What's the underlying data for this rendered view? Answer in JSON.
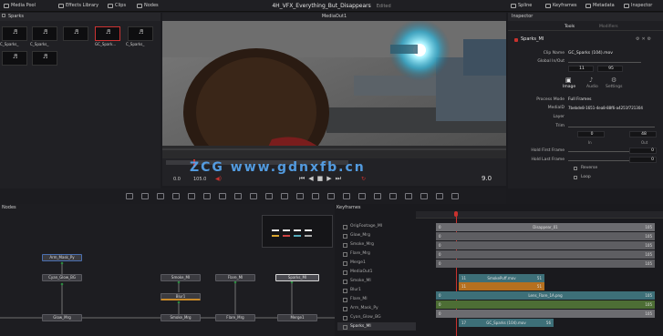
{
  "topbar": {
    "media_pool": "Media Pool",
    "effects_library": "Effects Library",
    "clips": "Clips",
    "nodes": "Nodes",
    "project_title": "4H_VFX_Everything_But_Disappears",
    "edited": "Edited",
    "spline": "Spline",
    "keyframes": "Keyframes",
    "metadata": "Metadata",
    "inspector": "Inspector"
  },
  "media_pool": {
    "bin": "Sparks",
    "clips": [
      "C_Sparks_",
      "C_Sparks_",
      "",
      "GC_Spark...",
      "C_Sparks_",
      "",
      ""
    ]
  },
  "viewer": {
    "title": "MediaOut1",
    "time_start": "0.0",
    "time_end": "105.0",
    "current_frame": "9.0"
  },
  "watermark": "ZCG www.gdnxfb.cn",
  "inspector": {
    "tab_tools": "Tools",
    "tab_modifiers": "Modifiers",
    "node_name": "Sparks_MI",
    "clip_name_label": "Clip Name",
    "clip_name": "GC_Sparks (104).mov",
    "global_inout_label": "Global In/Out",
    "global_in": "11",
    "global_out": "95",
    "subtabs": [
      "Image",
      "Audio",
      "Settings"
    ],
    "process_mode_label": "Process Mode",
    "process_mode": "Full Frames",
    "mediaid_label": "MediaID",
    "mediaid": "7bebde8-1651-4ea8-88f6-a4251f721304",
    "layer_label": "Layer",
    "trim_label": "Trim",
    "trim_in": "0",
    "trim_out": "48",
    "trim_in_label": "In",
    "trim_out_label": "Out",
    "hold_first_label": "Hold First Frame",
    "hold_first": "0",
    "hold_last_label": "Hold Last Frame",
    "hold_last": "0",
    "reverse_label": "Reverse",
    "loop_label": "Loop"
  },
  "nodes_panel": {
    "title": "Nodes",
    "nodes": [
      "Arm_Mask_Py",
      "Cyan_Glow_BG",
      "Glow_Mrg",
      "Smoke_Mrg",
      "Flare_Mrg",
      "Merge1",
      "Smoke_MI",
      "Blur1",
      "Flare_MI",
      "Sparks_MI"
    ]
  },
  "keyframes_panel": {
    "title": "Keyframes",
    "tracks": [
      "OrigFootage_MI",
      "Glow_Mrg",
      "Smoke_Mrg",
      "Flare_Mrg",
      "Merge1",
      "MediaOut1",
      "Smoke_MI",
      "Blur1",
      "Flare_MI",
      "Arm_Mask_Py",
      "Cyan_Glow_BG",
      "Sparks_MI"
    ],
    "bars": {
      "disappear_name": "Disappear_01",
      "start_0": "0",
      "end_105": "105",
      "smoke_name": "SmokePuff.mov",
      "smoke_in": "11",
      "smoke_out": "51",
      "lens_name": "Lens_Flare_1A.png",
      "sparks_name": "GC_Sparks (104).mov",
      "sparks_in": "17",
      "sparks_out": "56"
    }
  },
  "colors": {
    "accent_red": "#c8322e",
    "bar_grey": "#6c6c70",
    "bar_teal": "#3d6f78",
    "bar_orange": "#b5701f",
    "bar_green": "#4d6e35",
    "watermark_blue": "#5aafff"
  }
}
